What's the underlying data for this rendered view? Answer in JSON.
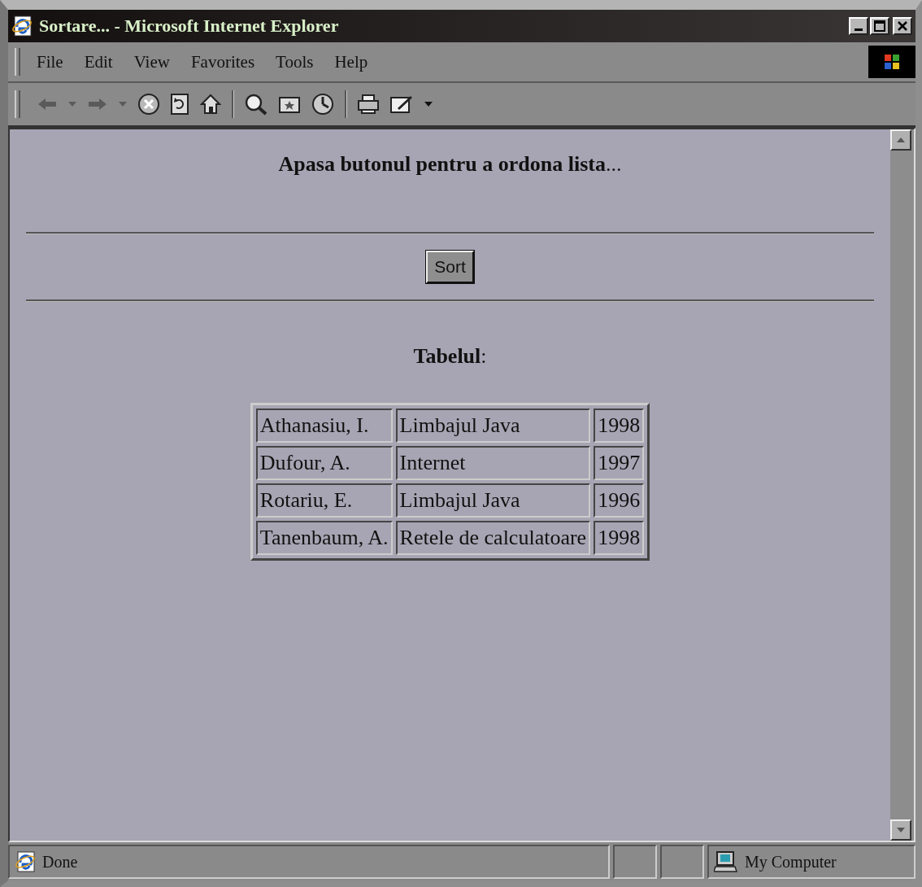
{
  "window": {
    "title": "Sortare... - Microsoft Internet Explorer"
  },
  "menu": [
    "File",
    "Edit",
    "View",
    "Favorites",
    "Tools",
    "Help"
  ],
  "page": {
    "heading": "**Apasa butonul pentru a ordona lista**...",
    "button": "Sort",
    "caption": "**Tabelul**:",
    "rows": [
      [
        "Athanasiu, I.",
        "Limbajul Java",
        "1998"
      ],
      [
        "Dufour, A.",
        "Internet",
        "1997"
      ],
      [
        "Rotariu, E.",
        "Limbajul Java",
        "1996"
      ],
      [
        "Tanenbaum, A.",
        "Retele de calculatoare",
        "1998"
      ]
    ]
  },
  "status_bar": {
    "text": "Done",
    "zone": "My Computer"
  }
}
